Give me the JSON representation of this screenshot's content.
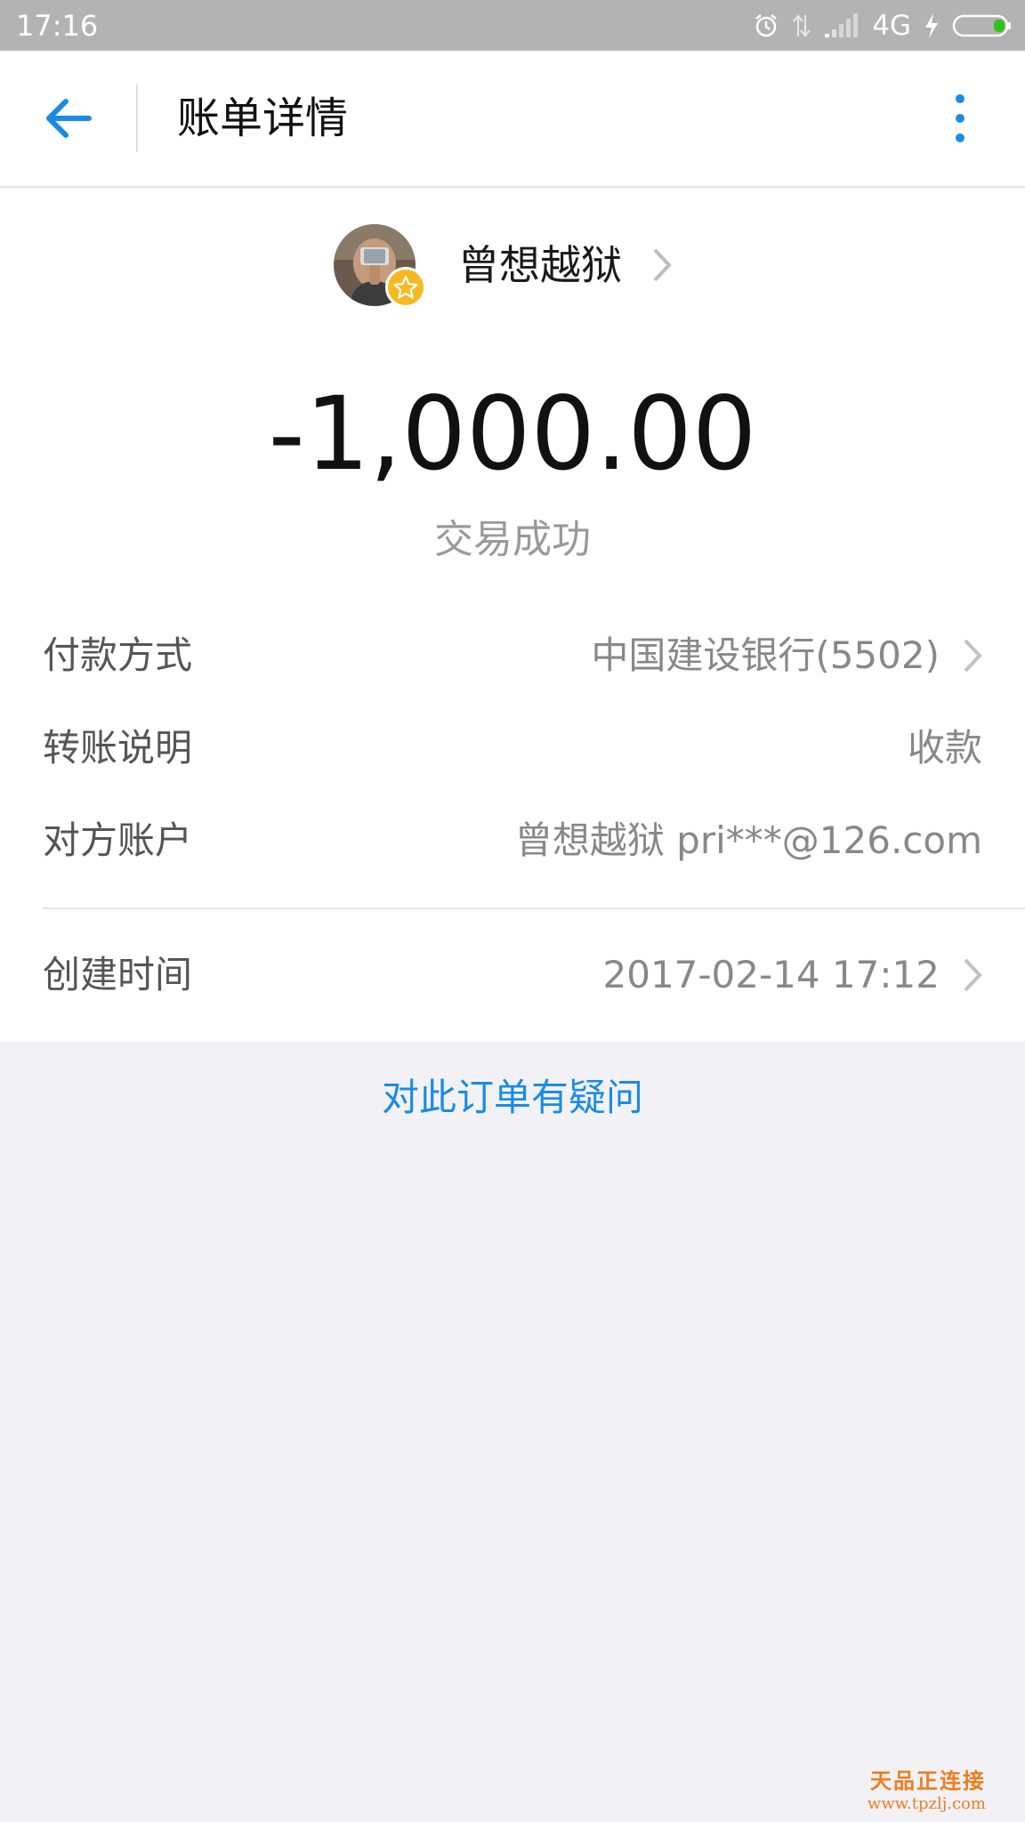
{
  "status_bar": {
    "time": "17:16",
    "network": "4G"
  },
  "header": {
    "title": "账单详情"
  },
  "payee": {
    "name": "曾想越狱"
  },
  "transaction": {
    "amount": "-1,000.00",
    "status": "交易成功",
    "rows": [
      {
        "label": "付款方式",
        "value": "中国建设银行(5502)"
      },
      {
        "label": "转账说明",
        "value": "收款"
      },
      {
        "label": "对方账户",
        "value": "曾想越狱 pri***@126.com"
      },
      {
        "label": "创建时间",
        "value": "2017-02-14 17:12"
      }
    ]
  },
  "question_link": "对此订单有疑问",
  "watermark": {
    "name": "天品正连接",
    "url": "www.tpzlj.com"
  },
  "colors": {
    "accent": "#1a8be5",
    "status_bar": "#b3b3b3",
    "page_bg": "#f2f2f6",
    "badge": "#f6b923"
  },
  "icons": [
    "back-arrow-icon",
    "more-vertical-icon",
    "chevron-right-icon",
    "star-badge-icon",
    "alarm-icon",
    "signal-icon",
    "battery-icon",
    "charging-icon"
  ]
}
